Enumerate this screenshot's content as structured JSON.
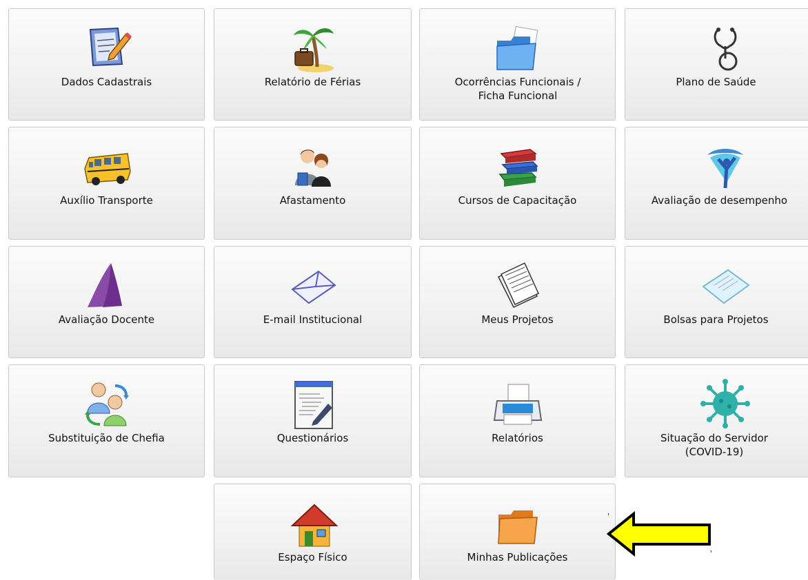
{
  "tiles": [
    {
      "label": "Dados Cadastrais",
      "icon": "form-pencil-icon"
    },
    {
      "label": "Relatório de Férias",
      "icon": "palm-tree-suitcase-icon"
    },
    {
      "label": "Ocorrências Funcionais / Ficha Funcional",
      "icon": "blue-folder-icon"
    },
    {
      "label": "Plano de Saúde",
      "icon": "stethoscope-icon"
    },
    {
      "label": "Auxílio Transporte",
      "icon": "school-bus-icon"
    },
    {
      "label": "Afastamento",
      "icon": "people-icon"
    },
    {
      "label": "Cursos de Capacitação",
      "icon": "books-icon"
    },
    {
      "label": "Avaliação de desempenho",
      "icon": "performance-figure-icon"
    },
    {
      "label": "Avaliação Docente",
      "icon": "purple-sail-icon"
    },
    {
      "label": "E-mail Institucional",
      "icon": "envelope-icon"
    },
    {
      "label": "Meus Projetos",
      "icon": "documents-stack-icon"
    },
    {
      "label": "Bolsas para Projetos",
      "icon": "paper-sheet-icon"
    },
    {
      "label": "Substituição de Chefia",
      "icon": "user-swap-icon"
    },
    {
      "label": "Questionários",
      "icon": "text-editor-icon"
    },
    {
      "label": "Relatórios",
      "icon": "printer-icon"
    },
    {
      "label": "Situação do Servidor (COVID-19)",
      "icon": "virus-icon"
    },
    {
      "label": "Espaço Físico",
      "icon": "house-icon"
    },
    {
      "label": "Minhas Publicações",
      "icon": "orange-folder-icon"
    }
  ],
  "colors": {
    "arrow_fill": "#ffff00",
    "tile_bg": "#f2f2f2",
    "tile_border": "#c9c9c9"
  }
}
